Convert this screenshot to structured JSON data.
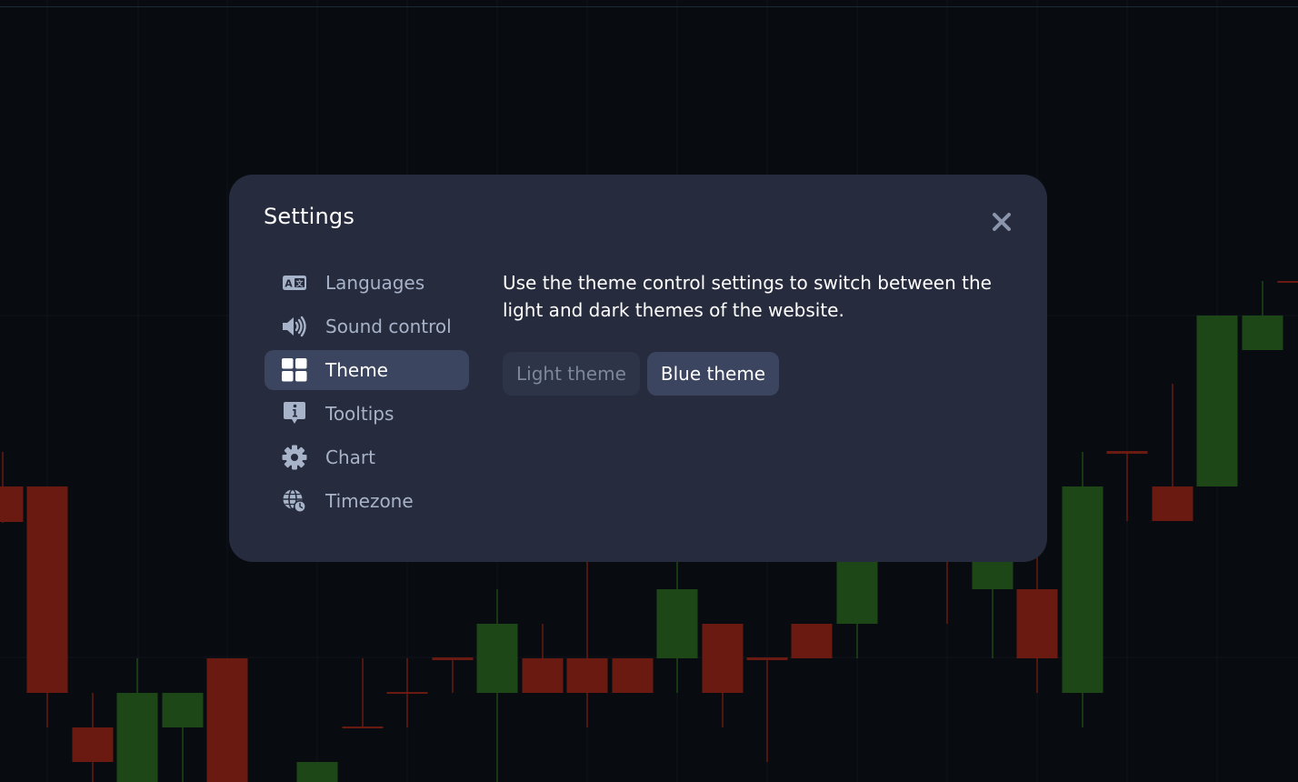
{
  "modal": {
    "title": "Settings",
    "close_icon": "close-icon"
  },
  "menu": {
    "items": [
      {
        "label": "Languages",
        "icon": "language-icon",
        "active": false
      },
      {
        "label": "Sound control",
        "icon": "speaker-icon",
        "active": false
      },
      {
        "label": "Theme",
        "icon": "grid-icon",
        "active": true
      },
      {
        "label": "Tooltips",
        "icon": "info-bubble-icon",
        "active": false
      },
      {
        "label": "Chart",
        "icon": "gear-icon",
        "active": false
      },
      {
        "label": "Timezone",
        "icon": "globe-clock-icon",
        "active": false
      }
    ]
  },
  "theme": {
    "description": "Use the theme control settings to switch between the light and dark themes of the website.",
    "options": [
      {
        "label": "Light theme",
        "selected": false
      },
      {
        "label": "Blue theme",
        "selected": true
      }
    ]
  },
  "colors": {
    "background": "#080b10",
    "modal": "#262b3d",
    "active_item": "#3b4560",
    "bull_candle": "#1d4716",
    "bear_candle": "#6b1a11",
    "icon": "#a7b3c9"
  }
}
